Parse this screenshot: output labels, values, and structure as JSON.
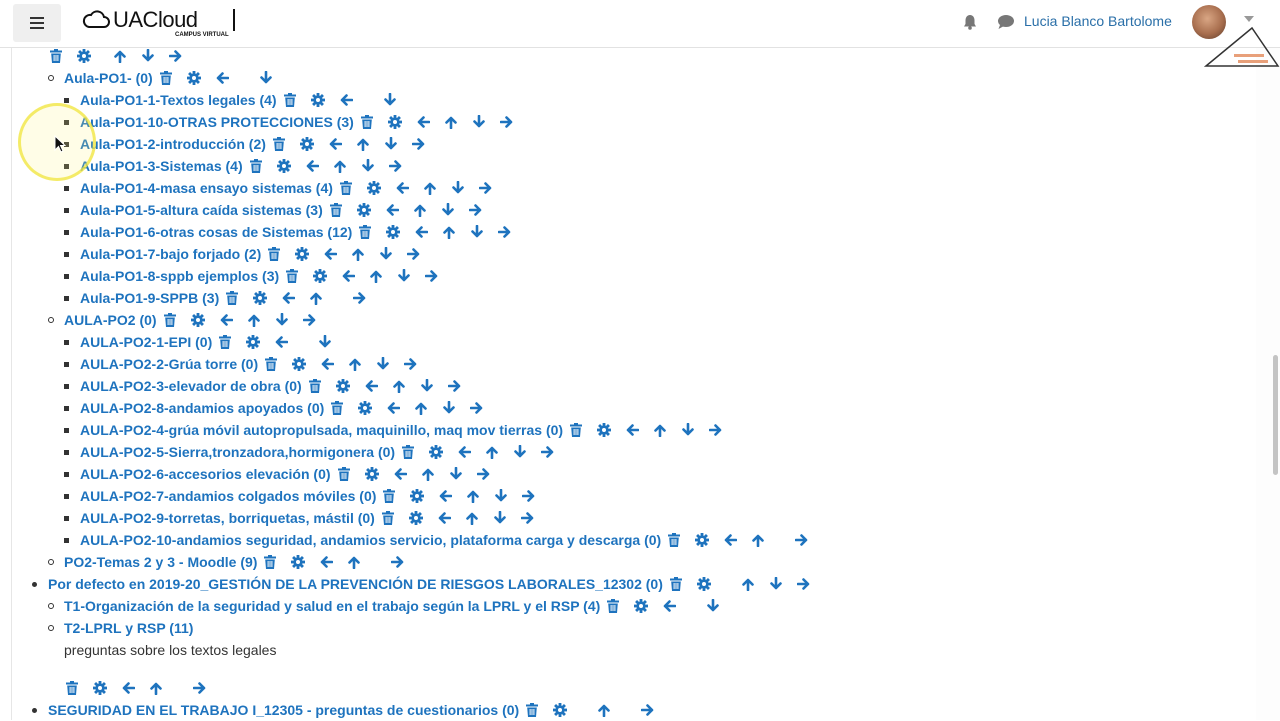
{
  "header": {
    "logo_main": "UACloud",
    "logo_sub": "CAMPUS VIRTUAL",
    "user_name": "Lucia Blanco Bartolome"
  },
  "tree": {
    "aula_po1": "Aula-PO1- (0)",
    "aula_po1_children": [
      "Aula-PO1-1-Textos legales (4)",
      "Aula-PO1-10-OTRAS PROTECCIONES (3)",
      "Aula-PO1-2-introducción (2)",
      "Aula-PO1-3-Sistemas (4)",
      "Aula-PO1-4-masa ensayo sistemas (4)",
      "Aula-PO1-5-altura caída sistemas (3)",
      "Aula-PO1-6-otras cosas de Sistemas (12)",
      "Aula-PO1-7-bajo forjado (2)",
      "Aula-PO1-8-sppb ejemplos (3)",
      "Aula-PO1-9-SPPB (3)"
    ],
    "aula_po2": "AULA-PO2 (0)",
    "aula_po2_children": [
      "AULA-PO2-1-EPI (0)",
      "AULA-PO2-2-Grúa torre (0)",
      "AULA-PO2-3-elevador de obra (0)",
      "AULA-PO2-8-andamios apoyados (0)",
      "AULA-PO2-4-grúa móvil autopropulsada, maquinillo, maq mov tierras (0)",
      "AULA-PO2-5-Sierra,tronzadora,hormigonera (0)",
      "AULA-PO2-6-accesorios elevación (0)",
      "AULA-PO2-7-andamios colgados móviles (0)",
      "AULA-PO2-9-torretas, borriquetas, mástil (0)",
      "AULA-PO2-10-andamios seguridad, andamios servicio, plataforma carga y descarga (0)"
    ],
    "po2_temas": "PO2-Temas 2 y 3 - Moodle (9)",
    "por_defecto": "Por defecto en 2019-20_GESTIÓN DE LA PREVENCIÓN DE RIESGOS LABORALES_12302 (0)",
    "t1": "T1-Organización de la seguridad y salud en el trabajo según la LPRL y el RSP (4)",
    "t2": "T2-LPRL y RSP (11)",
    "t2_description": "preguntas sobre los textos legales",
    "seguridad": "SEGURIDAD EN EL TRABAJO I_12305 - preguntas de cuestionarios (0)"
  },
  "icons": {
    "delete": "trash-icon",
    "edit": "gear-icon",
    "move_left": "arrow-left-icon",
    "move_up": "arrow-up-icon",
    "move_down": "arrow-down-icon",
    "move_right": "arrow-right-icon"
  },
  "colors": {
    "link": "#1e73be",
    "text": "#333333",
    "highlight": "#f0e43c"
  }
}
